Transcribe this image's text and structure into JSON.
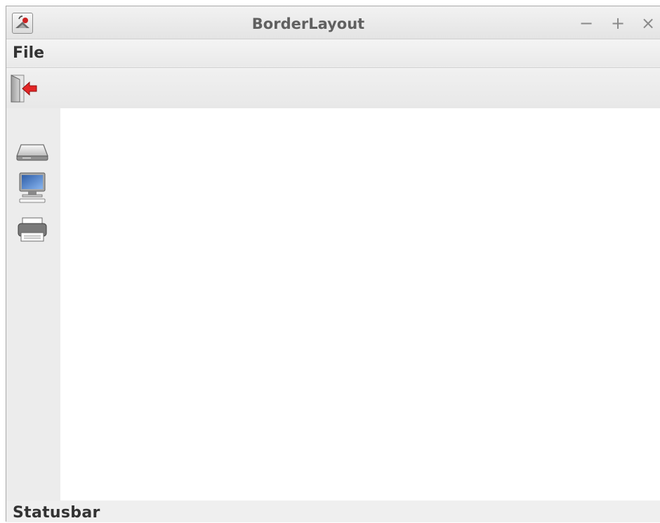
{
  "window": {
    "title": "BorderLayout",
    "controls": {
      "minimize": "−",
      "maximize": "+",
      "close": "×"
    },
    "app_icon": "java-app-icon"
  },
  "menubar": {
    "items": [
      {
        "label": "File"
      }
    ]
  },
  "toolbar": {
    "buttons": [
      {
        "icon": "exit-icon"
      }
    ]
  },
  "west_panel": {
    "buttons": [
      {
        "icon": "drive-icon"
      },
      {
        "icon": "computer-icon"
      },
      {
        "icon": "printer-icon"
      }
    ]
  },
  "statusbar": {
    "text": "Statusbar"
  },
  "colors": {
    "exit_arrow": "#e32626",
    "center_background": "#ffffff",
    "panel_background": "#ececec"
  }
}
